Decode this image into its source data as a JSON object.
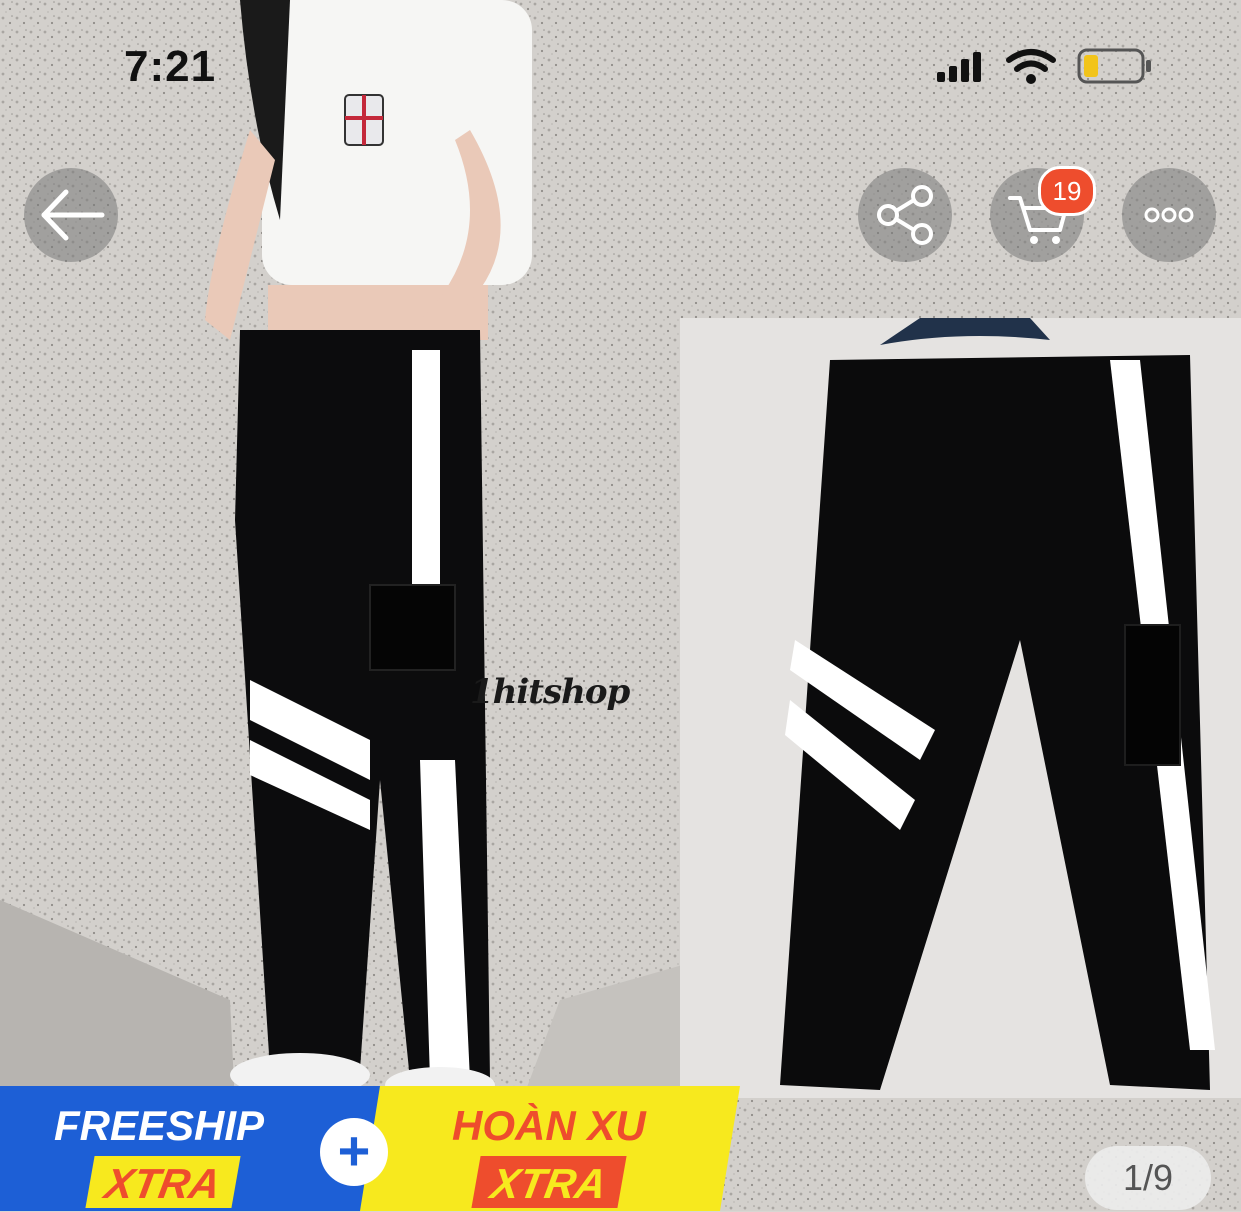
{
  "status_bar": {
    "time": "7:21"
  },
  "top_bar": {
    "back_icon": "arrow-left-icon",
    "share_icon": "share-icon",
    "cart_icon": "cart-icon",
    "more_icon": "more-horizontal-icon",
    "cart_count": "19"
  },
  "product_image": {
    "watermark": "1hitshop"
  },
  "promo": {
    "freeship_label": "FREESHIP",
    "freeship_xtra": "XTRA",
    "plus": "+",
    "hoanxu_label": "HOÀN XU",
    "hoanxu_xtra": "XTRA"
  },
  "gallery": {
    "page_indicator": "1/9"
  },
  "colors": {
    "brand_orange": "#ee4d2d",
    "promo_blue": "#1d5fd6",
    "promo_yellow": "#f7e91e"
  }
}
